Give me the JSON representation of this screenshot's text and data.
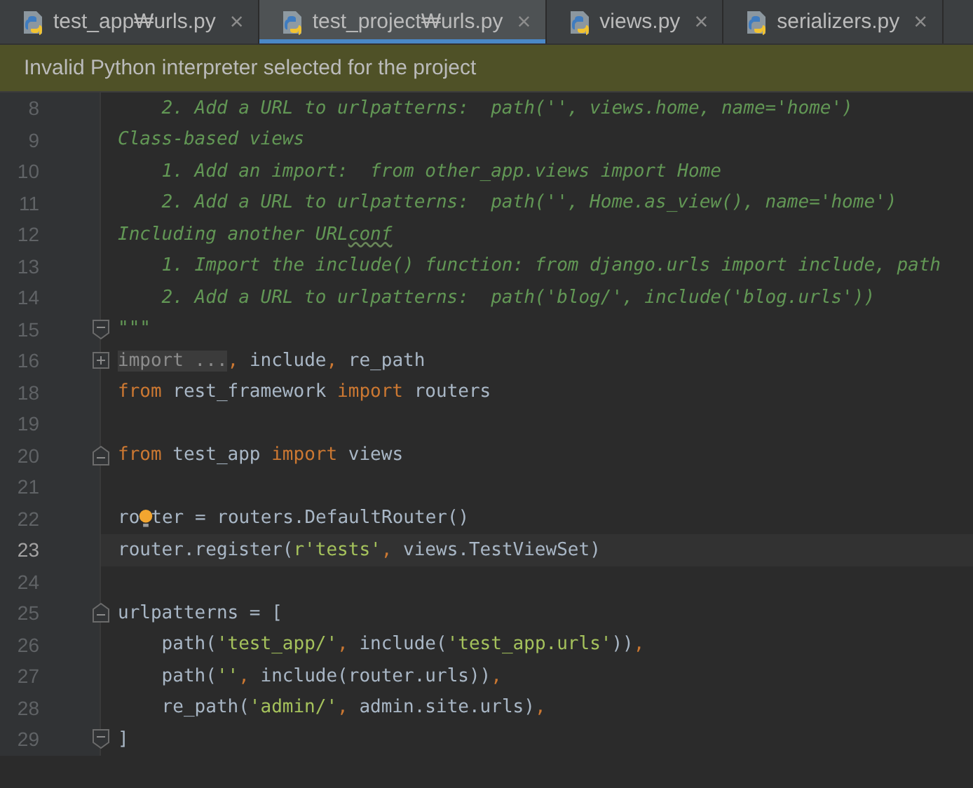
{
  "tabs": [
    {
      "label": "test_app₩urls.py",
      "close": "×",
      "selected": false
    },
    {
      "label": "test_project₩urls.py",
      "close": "×",
      "selected": true
    },
    {
      "label": "views.py",
      "close": "×",
      "selected": false
    },
    {
      "label": "serializers.py",
      "close": "×",
      "selected": false
    }
  ],
  "banner": {
    "text": "Invalid Python interpreter selected for the project"
  },
  "lines": [
    {
      "number": "8",
      "kind": "code",
      "current": false,
      "tokens": [
        {
          "kind": "comment",
          "text": "    2. Add a URL to urlpatterns:  path('', views.home, name='home')"
        }
      ]
    },
    {
      "number": "9",
      "kind": "code",
      "current": false,
      "tokens": [
        {
          "kind": "comment",
          "text": "Class-based views"
        }
      ]
    },
    {
      "number": "10",
      "kind": "code",
      "current": false,
      "tokens": [
        {
          "kind": "comment",
          "text": "    1. Add an import:  from other_app.views import Home"
        }
      ]
    },
    {
      "number": "11",
      "kind": "code",
      "current": false,
      "tokens": [
        {
          "kind": "comment",
          "text": "    2. Add a URL to urlpatterns:  path('', Home.as_view(), name='home')"
        }
      ]
    },
    {
      "number": "12",
      "kind": "code",
      "current": false,
      "tokens": [
        {
          "kind": "comment",
          "text": "Including another URL"
        },
        {
          "kind": "typo",
          "text": "conf"
        }
      ]
    },
    {
      "number": "13",
      "kind": "code",
      "current": false,
      "tokens": [
        {
          "kind": "comment",
          "text": "    1. Import the include() function: from django.urls import include, path"
        }
      ]
    },
    {
      "number": "14",
      "kind": "code",
      "current": false,
      "tokens": [
        {
          "kind": "comment",
          "text": "    2. Add a URL to urlpatterns:  path('blog/', include('blog.urls'))"
        }
      ]
    },
    {
      "number": "15",
      "kind": "fold-end",
      "current": false,
      "tokens": [
        {
          "kind": "comment",
          "text": "\"\"\""
        }
      ]
    },
    {
      "number": "16",
      "kind": "collapsed",
      "current": false,
      "tokens": [
        {
          "kind": "folded",
          "text": "import ..."
        },
        {
          "kind": "punct",
          "text": ", "
        },
        {
          "kind": "plain",
          "text": "include"
        },
        {
          "kind": "punct",
          "text": ", "
        },
        {
          "kind": "plain",
          "text": "re_path"
        }
      ]
    },
    {
      "number": "18",
      "kind": "code",
      "current": false,
      "tokens": [
        {
          "kind": "keyword",
          "text": "from "
        },
        {
          "kind": "plain",
          "text": "rest_framework "
        },
        {
          "kind": "keyword",
          "text": "import "
        },
        {
          "kind": "plain",
          "text": "routers"
        }
      ]
    },
    {
      "number": "19",
      "kind": "code",
      "current": false
    },
    {
      "number": "20",
      "kind": "fold-start",
      "current": false,
      "tokens": [
        {
          "kind": "keyword",
          "text": "from "
        },
        {
          "kind": "plain",
          "text": "test_app "
        },
        {
          "kind": "keyword",
          "text": "import "
        },
        {
          "kind": "plain",
          "text": "views"
        }
      ]
    },
    {
      "number": "21",
      "kind": "code",
      "current": false
    },
    {
      "number": "22",
      "kind": "code",
      "current": false,
      "tokens": [
        {
          "kind": "plain",
          "text": "ro"
        },
        {
          "kind": "bulb"
        },
        {
          "kind": "plain",
          "text": "ter = routers.DefaultRouter()"
        }
      ]
    },
    {
      "number": "23",
      "kind": "code",
      "current": true,
      "tokens": [
        {
          "kind": "plain",
          "text": "router.register("
        },
        {
          "kind": "string",
          "text": "r'tests'"
        },
        {
          "kind": "punct",
          "text": ", "
        },
        {
          "kind": "plain",
          "text": "views.TestViewSet)"
        }
      ]
    },
    {
      "number": "24",
      "kind": "code",
      "current": false
    },
    {
      "number": "25",
      "kind": "fold-start",
      "current": false,
      "tokens": [
        {
          "kind": "plain",
          "text": "urlpatterns = ["
        }
      ]
    },
    {
      "number": "26",
      "kind": "code",
      "current": false,
      "tokens": [
        {
          "kind": "plain",
          "text": "    path("
        },
        {
          "kind": "string",
          "text": "'test_app/'"
        },
        {
          "kind": "punct",
          "text": ", "
        },
        {
          "kind": "plain",
          "text": "include("
        },
        {
          "kind": "string",
          "text": "'test_app.urls'"
        },
        {
          "kind": "plain",
          "text": "))"
        },
        {
          "kind": "punct",
          "text": ","
        }
      ]
    },
    {
      "number": "27",
      "kind": "code",
      "current": false,
      "tokens": [
        {
          "kind": "plain",
          "text": "    path("
        },
        {
          "kind": "string",
          "text": "''"
        },
        {
          "kind": "punct",
          "text": ", "
        },
        {
          "kind": "plain",
          "text": "include(router.urls))"
        },
        {
          "kind": "punct",
          "text": ","
        }
      ]
    },
    {
      "number": "28",
      "kind": "code",
      "current": false,
      "tokens": [
        {
          "kind": "plain",
          "text": "    re_path("
        },
        {
          "kind": "string",
          "text": "'admin/'"
        },
        {
          "kind": "punct",
          "text": ", "
        },
        {
          "kind": "plain",
          "text": "admin.site.urls)"
        },
        {
          "kind": "punct",
          "text": ","
        }
      ]
    },
    {
      "number": "29",
      "kind": "fold-end",
      "current": false,
      "tokens": [
        {
          "kind": "plain",
          "text": "]"
        }
      ]
    }
  ]
}
